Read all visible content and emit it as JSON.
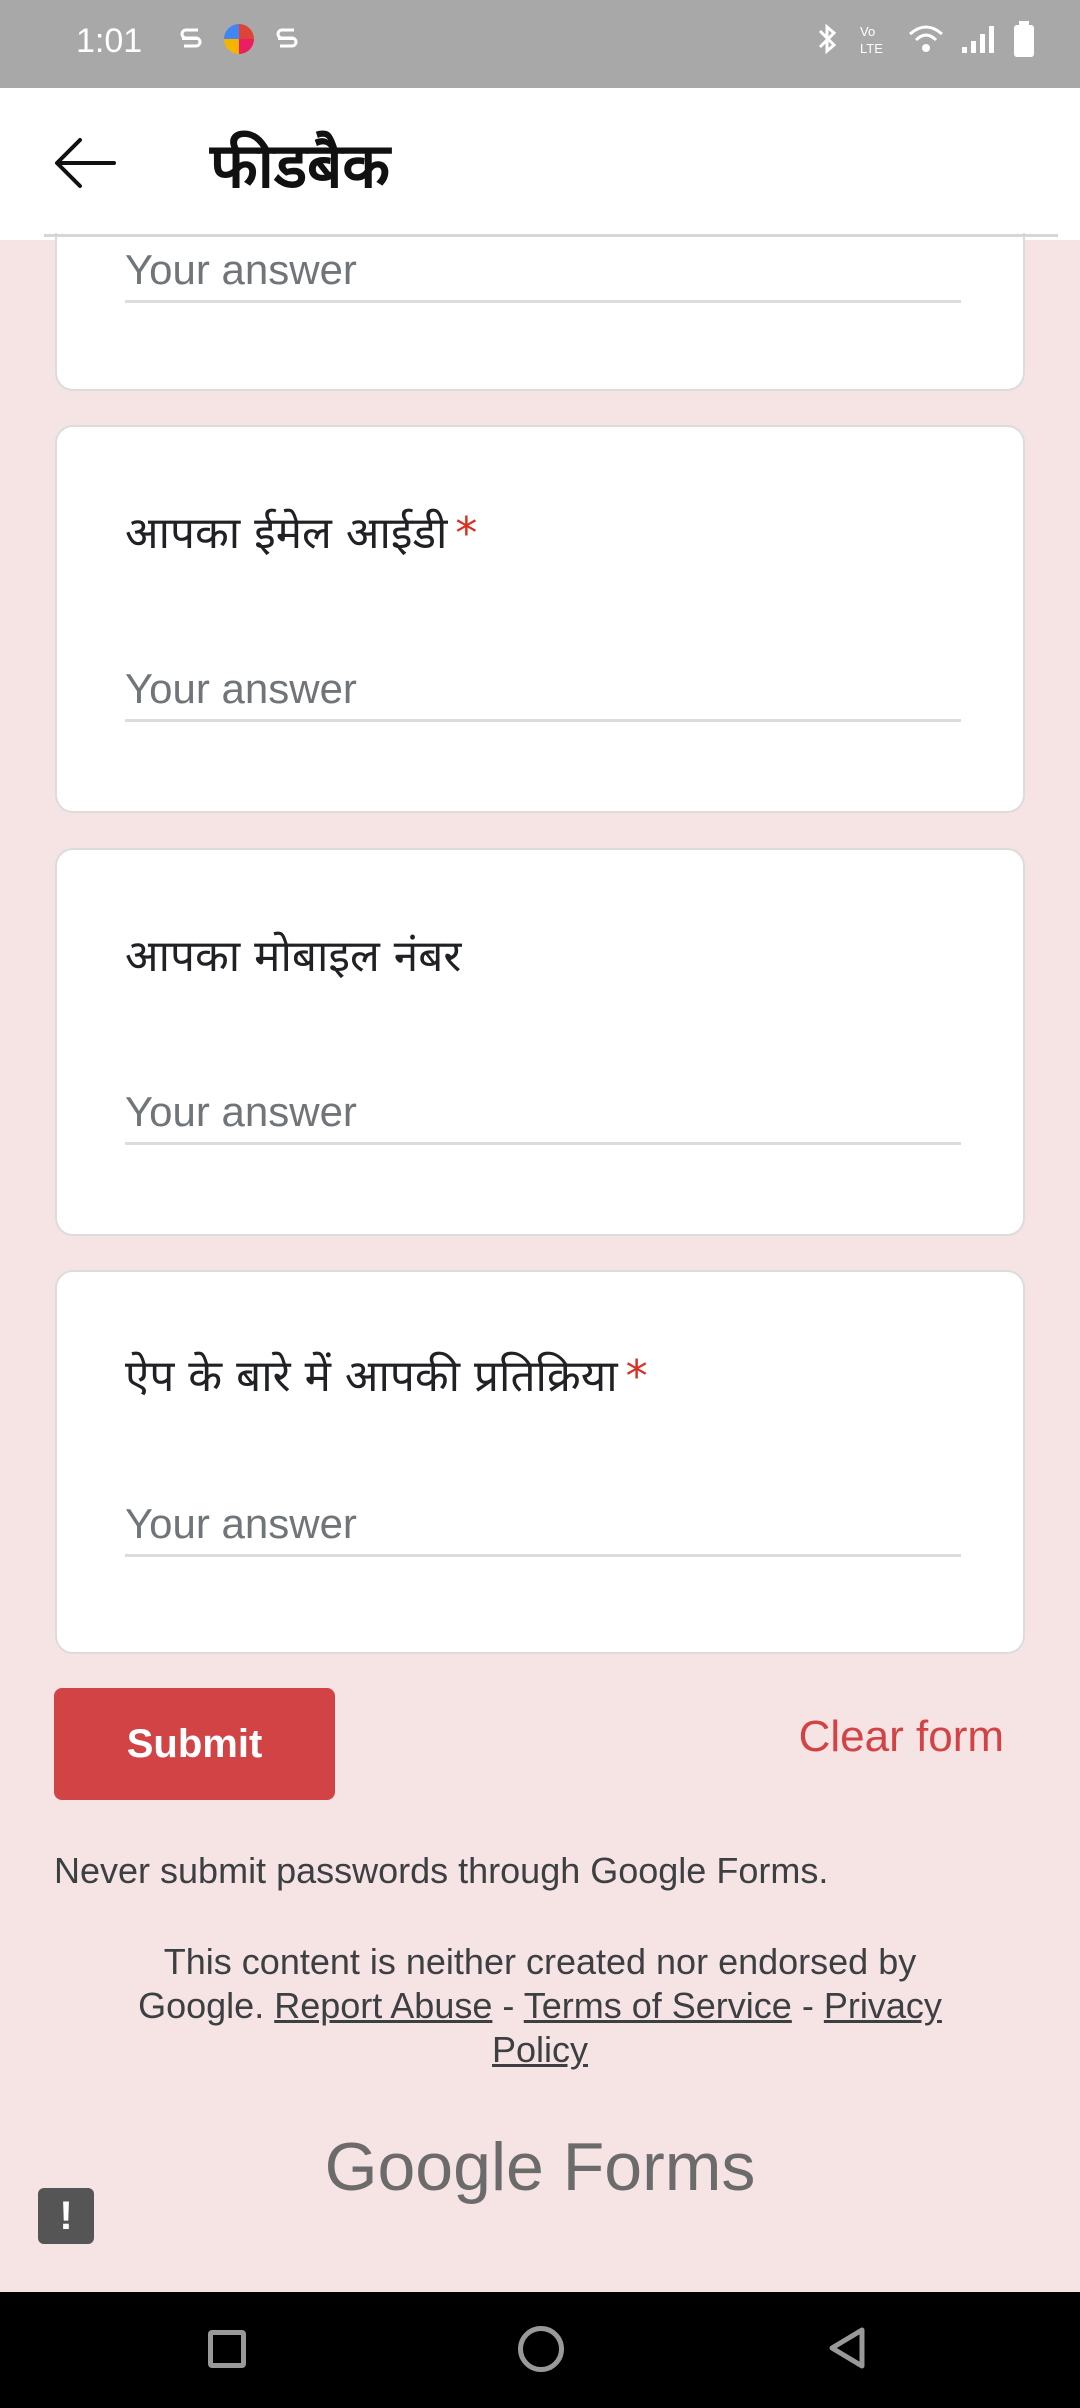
{
  "status_bar": {
    "time": "1:01"
  },
  "app_bar": {
    "title": "फीडबैक"
  },
  "questions": [
    {
      "label": "",
      "required": false,
      "placeholder": "Your answer"
    },
    {
      "label": "आपका ईमेल आईडी",
      "required": true,
      "placeholder": "Your answer"
    },
    {
      "label": "आपका मोबाइल नंबर",
      "required": false,
      "placeholder": "Your answer"
    },
    {
      "label": "ऐप के बारे में आपकी प्रतिक्रिया",
      "required": true,
      "placeholder": "Your answer"
    }
  ],
  "required_marker": "*",
  "actions": {
    "submit_label": "Submit",
    "clear_label": "Clear form"
  },
  "footer": {
    "warning": "Never submit passwords through Google Forms.",
    "disclaimer_prefix": "This content is neither created nor endorsed by Google.",
    "report_abuse": "Report Abuse",
    "separator": "-",
    "terms": "Terms of Service",
    "privacy": "Privacy Policy",
    "brand": "Google Forms"
  },
  "colors": {
    "accent": "#d24346",
    "background": "#f6e3e4"
  }
}
